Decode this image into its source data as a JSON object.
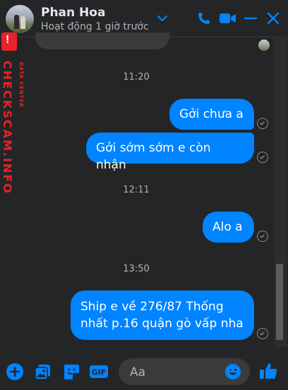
{
  "contact": {
    "name": "Phan Hoa",
    "status": "Hoạt động 1 giờ trước"
  },
  "watermark": {
    "main": "CHECKSCAM.INFO",
    "sub": "DATA CENTER",
    "logo": "!"
  },
  "conversation": {
    "times": [
      "11:20",
      "12:11",
      "13:50"
    ],
    "messages": [
      "Gởi chưa a",
      "Gởi sớm sớm e còn nhận",
      "Alo a",
      "Ship e về 276/87 Thống nhất p.16 quận gò vấp nha"
    ]
  },
  "composer": {
    "placeholder": "Aa"
  },
  "colors": {
    "accent": "#0084ff",
    "background": "#242526",
    "watermark": "#e8232a"
  },
  "icons": [
    "chevron-down-icon",
    "phone-icon",
    "video-icon",
    "minimize-icon",
    "close-icon",
    "plus-icon",
    "image-icon",
    "sticker-icon",
    "gif-icon",
    "emoji-icon",
    "like-icon"
  ]
}
